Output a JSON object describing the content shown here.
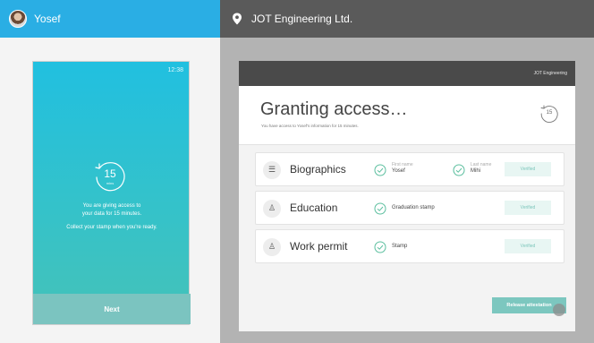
{
  "left": {
    "user_name": "Yosef",
    "phone": {
      "time": "12:38",
      "timer_value": "15",
      "timer_unit": "mins",
      "line1": "You are giving access to",
      "line2": "your data for 15 minutes.",
      "line3": "Collect your stamp when you're ready.",
      "next_label": "Next"
    }
  },
  "right": {
    "company_title": "JOT Engineering Ltd.",
    "browser": {
      "top_label": "JOT Engineering",
      "grant_title": "Granting access…",
      "grant_subtitle": "You have access to Yosef's information for 15 minutes.",
      "timer_value": "15",
      "rows": [
        {
          "icon": "biographics-icon",
          "title": "Biographics",
          "fields": [
            {
              "label": "First name",
              "value": "Yosef"
            },
            {
              "label": "Last name",
              "value": "Mihi"
            }
          ],
          "status": "Verified"
        },
        {
          "icon": "education-icon",
          "title": "Education",
          "fields": [
            {
              "label": "",
              "value": "Graduation stamp"
            }
          ],
          "status": "Verified"
        },
        {
          "icon": "work-permit-icon",
          "title": "Work permit",
          "fields": [
            {
              "label": "",
              "value": "Stamp"
            }
          ],
          "status": "Verified"
        }
      ],
      "release_label": "Release attestation"
    }
  },
  "colors": {
    "left_header": "#2aaee4",
    "right_header": "#5a5a5a",
    "phone_top": "#21c0e0",
    "phone_bottom": "#45c2b8",
    "check_green": "#5cbf9f",
    "button_teal": "#7cc7bf"
  }
}
